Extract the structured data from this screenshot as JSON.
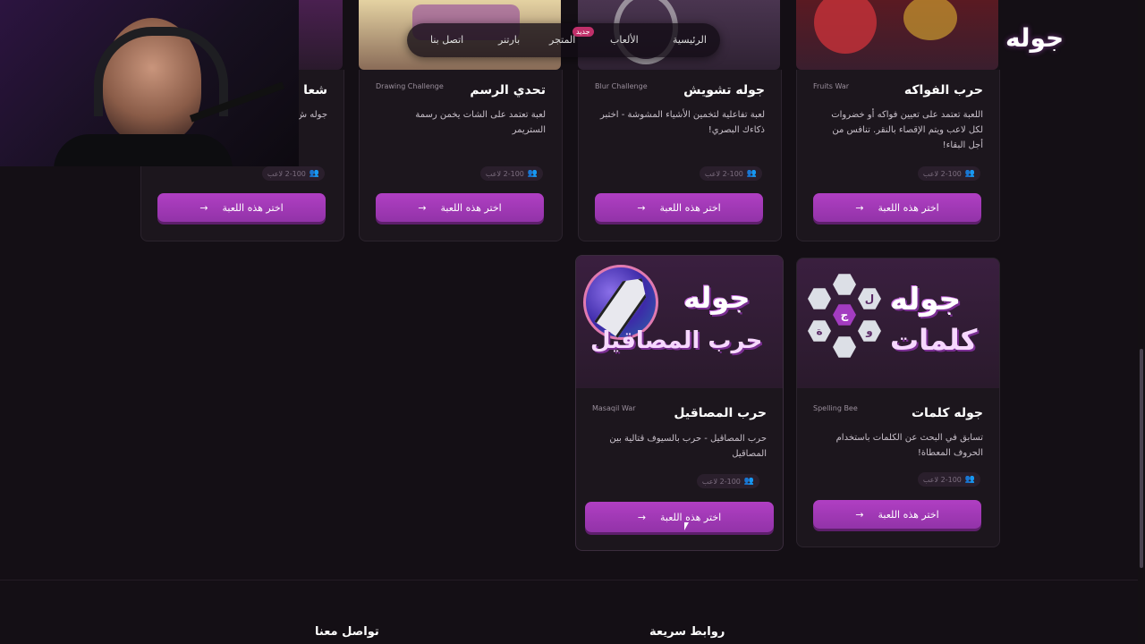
{
  "header": {
    "logo": "جوله",
    "nav": [
      "الرئيسية",
      "الألعاب",
      "المتجر",
      "بارتنر",
      "اتصل بنا"
    ],
    "new_badge": "جديد"
  },
  "cards": [
    {
      "title": "حرب الفواكه",
      "english": "Fruits War",
      "desc": "اللعبة تعتمد على تعيين فواكه أو خضروات لكل لاعب ويتم الإقصاء بالنقر. تنافس من أجل البقاء!",
      "players": "2-100 لاعب",
      "button": "اختر هذه اللعبة"
    },
    {
      "title": "جوله تشويش",
      "english": "Blur Challenge",
      "desc": "لعبة تفاعلية لتخمين الأشياء المشوشة - اختبر ذكاءك البصري!",
      "players": "2-100 لاعب",
      "button": "اختر هذه اللعبة"
    },
    {
      "title": "تحدي الرسم",
      "english": "Drawing Challenge",
      "desc": "لعبة تعتمد على الشات يخمن رسمة الستريمر",
      "players": "2-100 لاعب",
      "button": "اختر هذه اللعبة"
    },
    {
      "title": "شعا",
      "english": "",
      "desc": "جوله ش لشركات",
      "players": "2-100 لاعب",
      "button": "اختر هذه اللعبة"
    },
    {
      "title": "جوله كلمات",
      "english": "Spelling Bee",
      "desc": "تسابق في البحث عن الكلمات باستخدام الحروف المعطاة!",
      "players": "2-100 لاعب",
      "button": "اختر هذه اللعبة",
      "art_line1": "جوله",
      "art_line2": "كلمات",
      "hex_letters": [
        "ل",
        "ج",
        "و",
        "ة"
      ]
    },
    {
      "title": "حرب المصاقيل",
      "english": "Masaqil War",
      "desc": "حرب المصاقيل - حرب بالسيوف قتالية بين المصاقيل",
      "players": "2-100 لاعب",
      "button": "اختر هذه اللعبة",
      "art_line1": "جوله",
      "art_line2": "حرب المصاقيل"
    }
  ],
  "footer": {
    "contact": "تواصل معنا",
    "quick_links": "روابط سريعة"
  },
  "icons": {
    "players": "users-icon",
    "arrow": "arrow-left-icon"
  },
  "colors": {
    "accent": "#a33cc0",
    "background": "#140f15",
    "card": "#1c161d"
  }
}
